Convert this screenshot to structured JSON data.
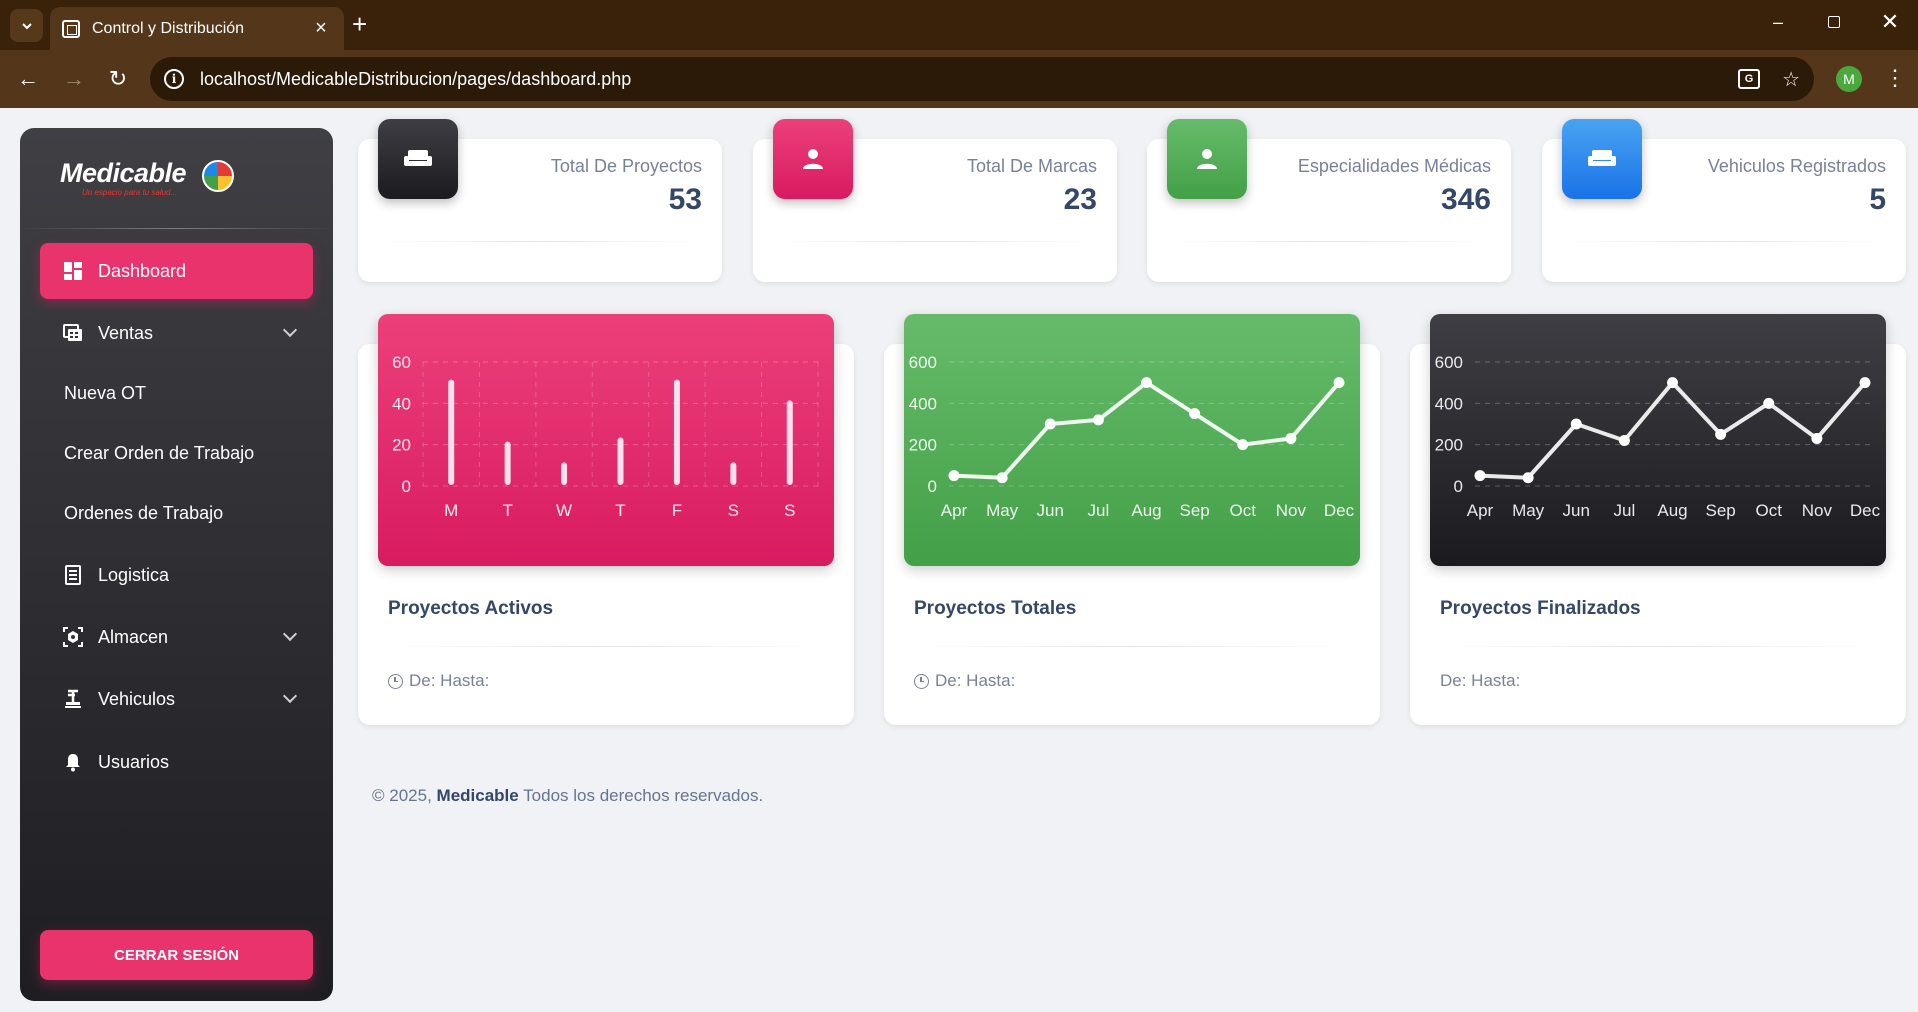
{
  "browser": {
    "tab_title": "Control y Distribución",
    "url": "localhost/MedicableDistribucion/pages/dashboard.php",
    "profile_initial": "M"
  },
  "sidebar": {
    "logo_text": "Medicable",
    "logo_tagline": "Un espacio para tu salud...",
    "items": [
      {
        "label": "Dashboard",
        "icon": "dashboard-icon",
        "active": true
      },
      {
        "label": "Ventas",
        "icon": "sales-icon",
        "expandable": true
      },
      {
        "label": "Nueva OT"
      },
      {
        "label": "Crear Orden de Trabajo"
      },
      {
        "label": "Ordenes de Trabajo"
      },
      {
        "label": "Logistica",
        "icon": "logistics-icon"
      },
      {
        "label": "Almacen",
        "icon": "warehouse-icon",
        "expandable": true
      },
      {
        "label": "Vehiculos",
        "icon": "vehicle-icon",
        "expandable": true
      },
      {
        "label": "Usuarios",
        "icon": "bell-icon"
      }
    ],
    "logout_label": "CERRAR SESIÓN"
  },
  "stats": [
    {
      "label": "Total De Proyectos",
      "value": "53",
      "icon": "sofa-icon",
      "color": "#2c2c30"
    },
    {
      "label": "Total De Marcas",
      "value": "23",
      "icon": "user-icon",
      "color": "#e91e63"
    },
    {
      "label": "Especialidades Médicas",
      "value": "346",
      "icon": "user-icon",
      "color": "#4caf50"
    },
    {
      "label": "Vehiculos Registrados",
      "value": "5",
      "icon": "sofa-icon",
      "color": "#1a73e8"
    }
  ],
  "charts": [
    {
      "title": "Proyectos Activos",
      "meta": "De: Hasta:",
      "has_clock": true
    },
    {
      "title": "Proyectos Totales",
      "meta": "De: Hasta:",
      "has_clock": true
    },
    {
      "title": "Proyectos Finalizados",
      "meta": "De: Hasta:",
      "has_clock": false
    }
  ],
  "chart_data": [
    {
      "type": "bar",
      "categories": [
        "M",
        "T",
        "W",
        "T",
        "F",
        "S",
        "S"
      ],
      "values": [
        50,
        20,
        10,
        22,
        50,
        10,
        40
      ],
      "yticks": [
        0,
        20,
        40,
        60
      ],
      "ylim": [
        0,
        60
      ],
      "background": "#e91e63",
      "grid": true
    },
    {
      "type": "line",
      "categories": [
        "Apr",
        "May",
        "Jun",
        "Jul",
        "Aug",
        "Sep",
        "Oct",
        "Nov",
        "Dec"
      ],
      "values": [
        50,
        40,
        300,
        320,
        500,
        350,
        200,
        230,
        500
      ],
      "yticks": [
        0,
        200,
        400,
        600
      ],
      "ylim": [
        0,
        600
      ],
      "background": "#4caf50",
      "grid": true
    },
    {
      "type": "line",
      "categories": [
        "Apr",
        "May",
        "Jun",
        "Jul",
        "Aug",
        "Sep",
        "Oct",
        "Nov",
        "Dec"
      ],
      "values": [
        50,
        40,
        300,
        220,
        500,
        250,
        400,
        230,
        500
      ],
      "yticks": [
        0,
        200,
        400,
        600
      ],
      "ylim": [
        0,
        600
      ],
      "background": "#2c2c30",
      "grid": true
    }
  ],
  "footer": {
    "prefix": "© 2025,",
    "brand": "Medicable",
    "suffix": "Todos los derechos reservados."
  }
}
